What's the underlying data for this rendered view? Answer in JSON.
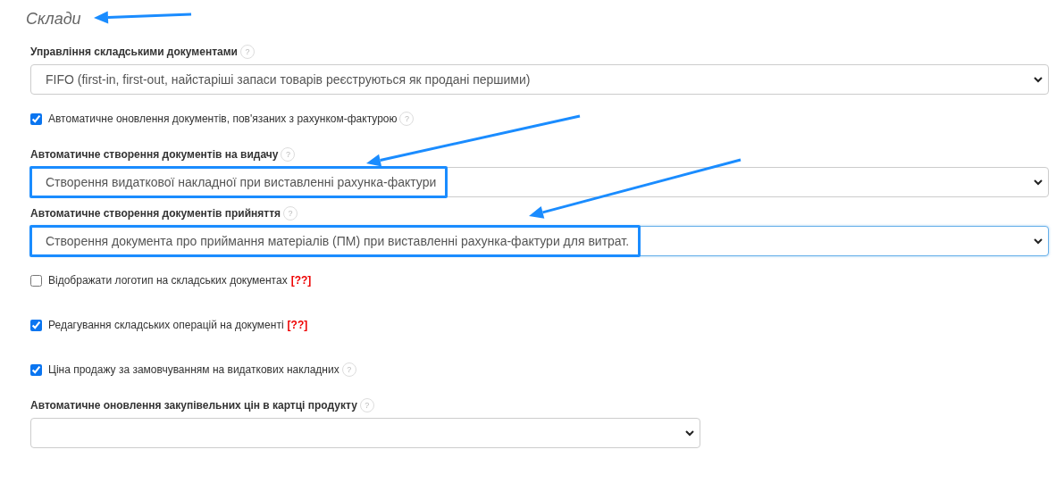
{
  "title": {
    "text": "Склади",
    "arrow": true
  },
  "settings": [
    {
      "kind": "select",
      "label": "Управління складськими документами",
      "help": "?",
      "value": "FIFO (first-in, first-out, найстаріші запаси товарів реєструються як продані першими)",
      "wide": true,
      "highlighted": false,
      "focused": false,
      "arrow": false
    },
    {
      "kind": "checkbox",
      "label": "Автоматичне оновлення документів, пов'язаних з рахунком-фактурою",
      "help": "?",
      "checked": true
    },
    {
      "kind": "select",
      "label": "Автоматичне створення документів на видачу",
      "help": "?",
      "value": "Створення видаткової накладної при виставленні рахунка-фактури",
      "wide": true,
      "highlighted": true,
      "focused": false,
      "arrow": true
    },
    {
      "kind": "select",
      "label": "Автоматичне створення документів прийняття",
      "help": "?",
      "value": "Створення документа про приймання матеріалів (ПМ) при виставленні рахунка-фактури для витрат.",
      "wide": true,
      "highlighted": true,
      "focused": true,
      "arrow": true
    },
    {
      "kind": "checkbox",
      "label": "Відображати логотип на складських документах",
      "badge": "[??]",
      "checked": false
    },
    {
      "kind": "checkbox",
      "label": "Редагування складських операцій на документі",
      "badge": "[??]",
      "checked": true
    },
    {
      "kind": "checkbox",
      "label": "Ціна продажу за замовчуванням на видаткових накладних",
      "help": "?",
      "checked": true
    },
    {
      "kind": "select",
      "label": "Автоматичне оновлення закупівельних цін в картці продукту",
      "help": "?",
      "wide": false,
      "highlighted": false,
      "focused": false,
      "arrow": false
    }
  ]
}
